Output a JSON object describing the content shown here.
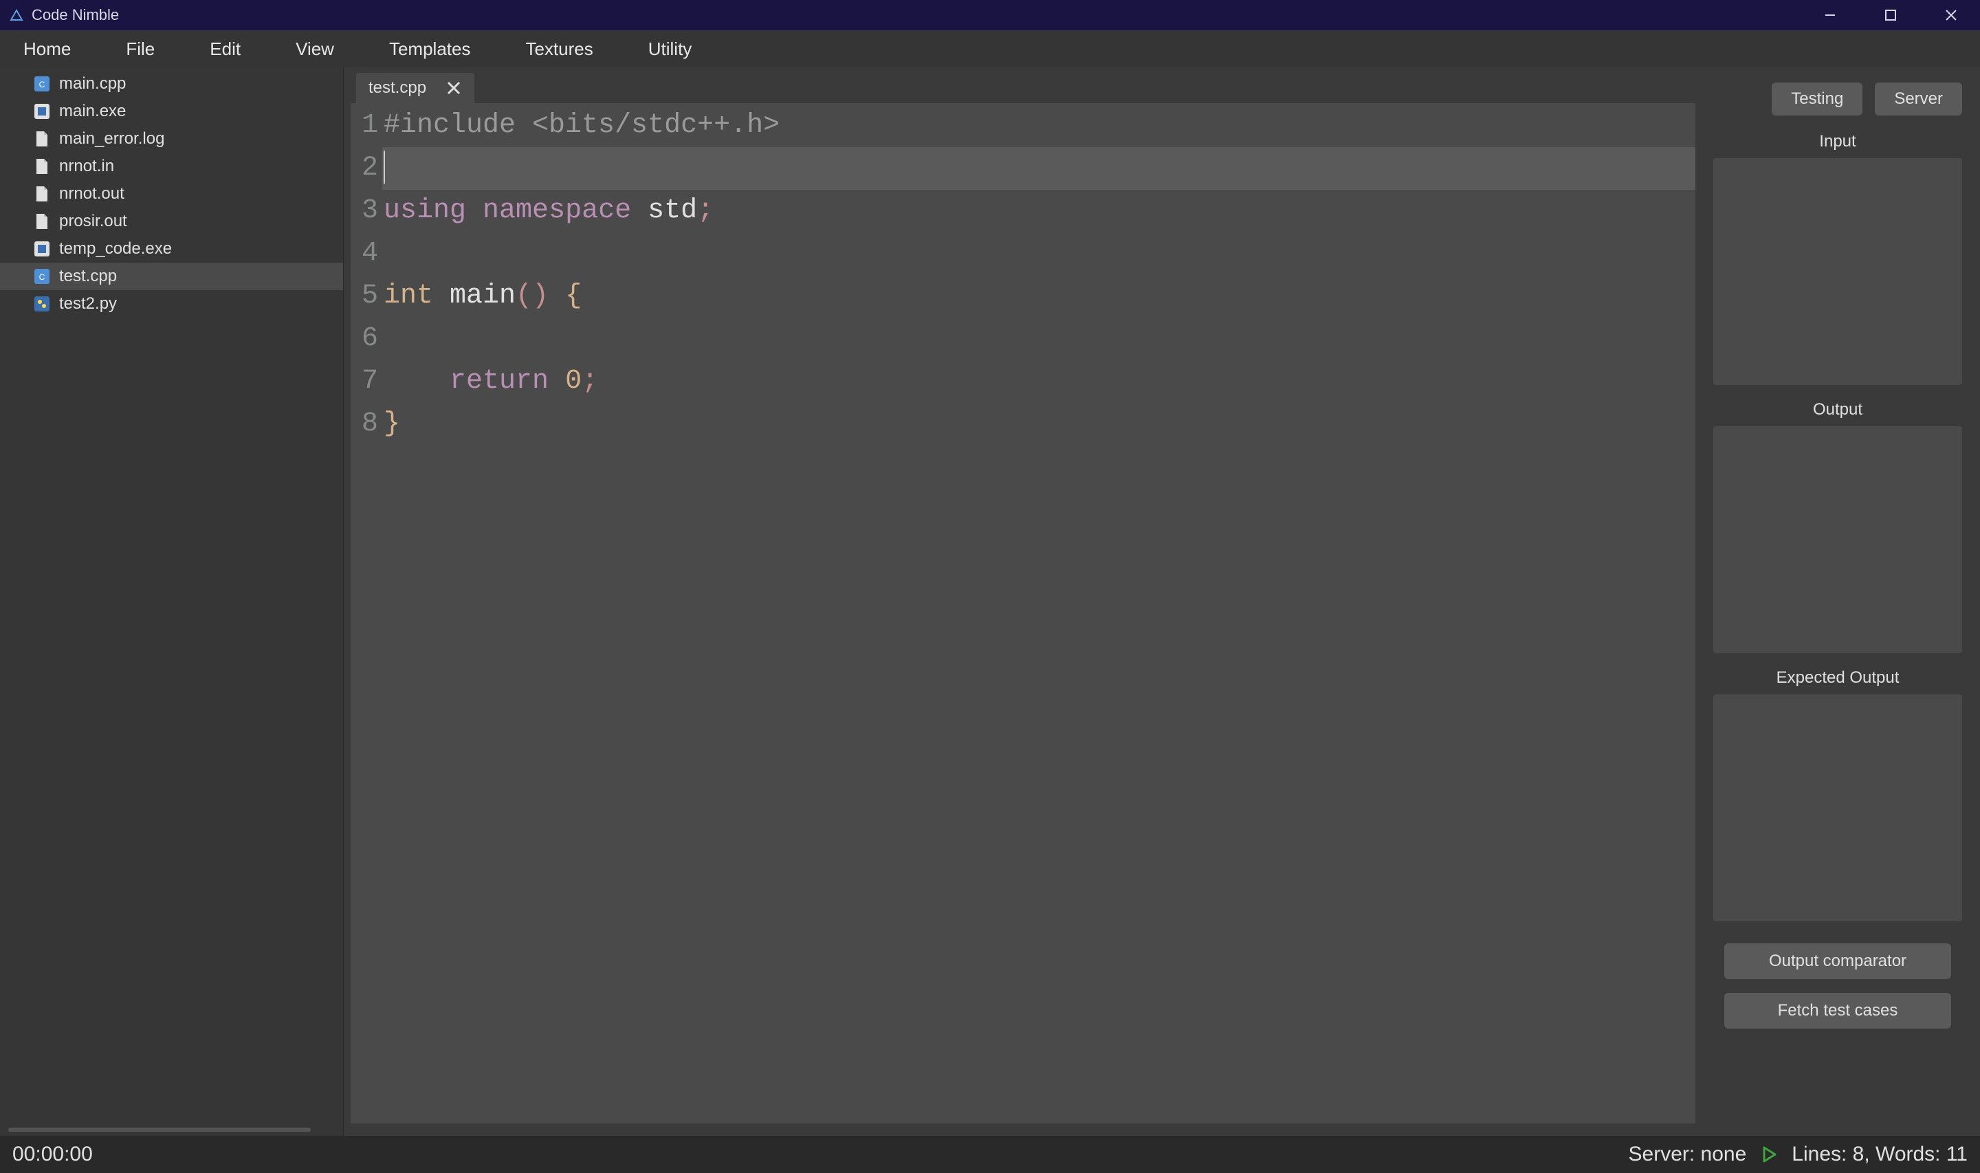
{
  "titlebar": {
    "title": "Code Nimble"
  },
  "menu": {
    "items": [
      "Home",
      "File",
      "Edit",
      "View",
      "Templates",
      "Textures",
      "Utility"
    ]
  },
  "sidebar": {
    "files": [
      {
        "name": "main.cpp",
        "icon": "cpp",
        "selected": false
      },
      {
        "name": "main.exe",
        "icon": "exe",
        "selected": false
      },
      {
        "name": "main_error.log",
        "icon": "file",
        "selected": false
      },
      {
        "name": "nrnot.in",
        "icon": "file",
        "selected": false
      },
      {
        "name": "nrnot.out",
        "icon": "file",
        "selected": false
      },
      {
        "name": "prosir.out",
        "icon": "file",
        "selected": false
      },
      {
        "name": "temp_code.exe",
        "icon": "exe",
        "selected": false
      },
      {
        "name": "test.cpp",
        "icon": "cpp",
        "selected": true
      },
      {
        "name": "test2.py",
        "icon": "py",
        "selected": false
      }
    ]
  },
  "tabs": [
    {
      "label": "test.cpp",
      "active": true
    }
  ],
  "editor": {
    "current_line": 2,
    "lines": [
      [
        {
          "t": "#include <bits/stdc++.h>",
          "c": "tok-preproc"
        }
      ],
      [],
      [
        {
          "t": "using",
          "c": "tok-keyword"
        },
        {
          "t": " ",
          "c": ""
        },
        {
          "t": "namespace",
          "c": "tok-keyword"
        },
        {
          "t": " ",
          "c": ""
        },
        {
          "t": "std",
          "c": "tok-ident"
        },
        {
          "t": ";",
          "c": "tok-punct"
        }
      ],
      [],
      [
        {
          "t": "int",
          "c": "tok-type"
        },
        {
          "t": " ",
          "c": ""
        },
        {
          "t": "main",
          "c": "tok-ident"
        },
        {
          "t": "()",
          "c": "tok-punct"
        },
        {
          "t": " ",
          "c": ""
        },
        {
          "t": "{",
          "c": "tok-brace"
        }
      ],
      [],
      [
        {
          "t": "    ",
          "c": ""
        },
        {
          "t": "return",
          "c": "tok-keyword"
        },
        {
          "t": " ",
          "c": ""
        },
        {
          "t": "0",
          "c": "tok-number"
        },
        {
          "t": ";",
          "c": "tok-punct"
        }
      ],
      [
        {
          "t": "}",
          "c": "tok-brace"
        }
      ]
    ]
  },
  "right_panel": {
    "btn_testing": "Testing",
    "btn_server": "Server",
    "label_input": "Input",
    "label_output": "Output",
    "label_expected": "Expected Output",
    "btn_comparator": "Output comparator",
    "btn_fetch": "Fetch test cases"
  },
  "status": {
    "timer": "00:00:00",
    "server": "Server: none",
    "lines_words": "Lines: 8, Words: 11"
  }
}
